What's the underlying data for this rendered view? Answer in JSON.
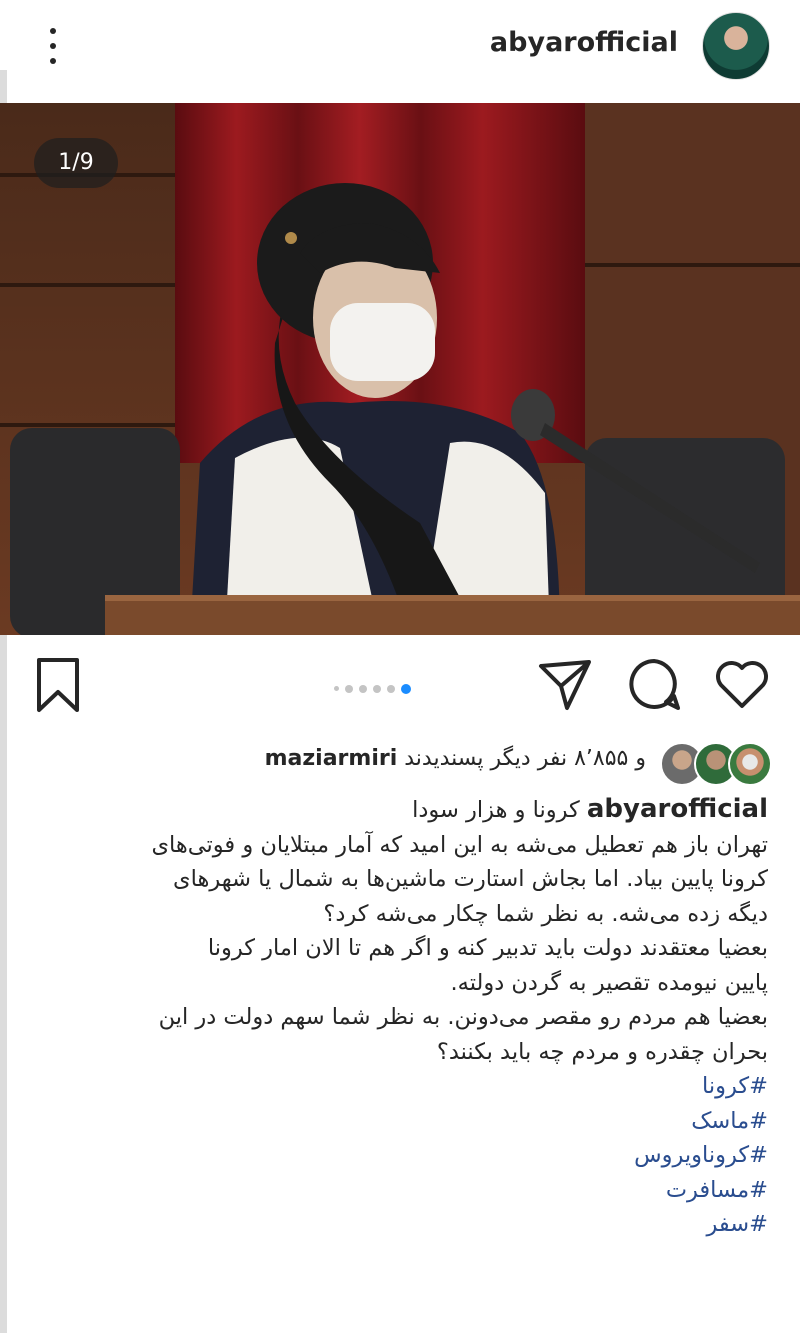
{
  "header": {
    "username": "abyarofficial",
    "more_icon": "more-vertical-icon",
    "avatar_icon": "profile-avatar"
  },
  "photo": {
    "counter": "1/9"
  },
  "actions": {
    "icons": [
      "bookmark-icon",
      "send-icon",
      "comment-icon",
      "heart-icon"
    ],
    "carousel_total": 6,
    "carousel_active": 6,
    "active_color": "#1a8cff"
  },
  "likes": {
    "prefix": "و ۸٬۸۵۵ نفر دیگر پسندیدند",
    "user": "maziarmiri"
  },
  "caption": {
    "username": "abyarofficial",
    "title": "کرونا و هزار سودا",
    "lines": [
      "تهران باز هم تعطیل می‌شه به این امید که آمار مبتلایان و فوتی‌های",
      "کرونا پایین بیاد. اما بجاش استارت ماشین‌ها به شمال یا شهرهای",
      "دیگه زده می‌شه. به نظر شما چکار می‌شه کرد؟",
      "بعضیا معتقدند دولت باید تدبیر کنه و اگر هم تا الان امار کرونا",
      "پایین نیومده تقصیر به گردن دولته.",
      "بعضیا هم مردم رو مقصر می‌دونن. به نظر شما سهم دولت در این",
      "بحران چقدره و مردم چه باید بکنند؟"
    ],
    "hashtags": [
      "#کرونا",
      "#ماسک",
      "#کروناویروس",
      "#مسافرت",
      "#سفر"
    ],
    "hashtag_color": "#2a4d8f"
  }
}
